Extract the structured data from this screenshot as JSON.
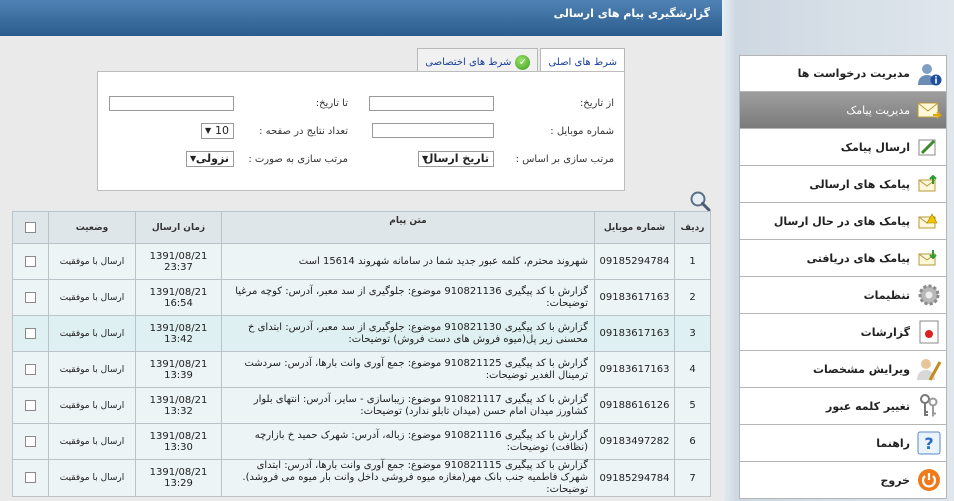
{
  "header": {
    "title": "گزارشگیری پیام های ارسالی"
  },
  "tabs": [
    {
      "label": "شرط های اصلی",
      "active": true
    },
    {
      "label": "شرط های اختصاصی",
      "active": false
    }
  ],
  "filters": {
    "from_date_label": "از تاریخ:",
    "to_date_label": "تا تاریخ:",
    "mobile_label": "شماره موبایل :",
    "page_size_label": "تعداد نتایج در صفحه :",
    "page_size_value": "10",
    "sort_by_label": "مرتب سازی بر اساس :",
    "sort_by_value": "تاریخ ارسال",
    "sort_order_label": "مرتب سازی به صورت :",
    "sort_order_value": "نزولی"
  },
  "table": {
    "columns": [
      "ردیف",
      "شماره موبایل",
      "متن پیام",
      "زمان ارسال",
      "وضعیت"
    ],
    "rows": [
      {
        "n": "1",
        "mobile": "09185294784",
        "text": "شهروند محترم، کلمه عبور جدید شما در سامانه شهروند 15614 است",
        "time": "1391/08/21 23:37",
        "status": "ارسال با موفقیت"
      },
      {
        "n": "2",
        "mobile": "09183617163",
        "text": "گزارش با کد پیگیری 910821136 موضوع: جلوگیری از سد معبر، آدرس: کوچه مرغیا توضیحات:",
        "time": "1391/08/21 16:54",
        "status": "ارسال با موفقیت"
      },
      {
        "n": "3",
        "mobile": "09183617163",
        "text": "گزارش با کد پیگیری 910821130 موضوع: جلوگیری از سد معبر، آدرس: ابتدای خ محسنی زیر پل(میوه فروش های دست فروش) توضیحات:",
        "time": "1391/08/21 13:42",
        "status": "ارسال با موفقیت"
      },
      {
        "n": "4",
        "mobile": "09183617163",
        "text": "گزارش با کد پیگیری 910821125 موضوع: جمع آوری وانت بارها، آدرس: سردشت ترمینال الغدیر توضیحات:",
        "time": "1391/08/21 13:39",
        "status": "ارسال با موفقیت"
      },
      {
        "n": "5",
        "mobile": "09188616126",
        "text": "گزارش با کد پیگیری 910821117 موضوع: زیباسازی - سایر، آدرس: انتهای بلوار کشاورز میدان امام حسن (میدان تابلو ندارد) توضیحات:",
        "time": "1391/08/21 13:32",
        "status": "ارسال با موفقیت"
      },
      {
        "n": "6",
        "mobile": "09183497282",
        "text": "گزارش با کد پیگیری 910821116 موضوع: زباله، آدرس: شهرک حمید خ بازارچه (نظافت) توضیحات:",
        "time": "1391/08/21 13:30",
        "status": "ارسال با موفقیت"
      },
      {
        "n": "7",
        "mobile": "09185294784",
        "text": "گزارش با کد پیگیری 910821115 موضوع: جمع آوری وانت بارها، آدرس: ابتدای شهرک فاطمیه جنب بانک مهر(مغازه میوه فروشی داخل وانت بار میوه می فروشد). توضیحات:",
        "time": "1391/08/21 13:29",
        "status": "ارسال با موفقیت"
      }
    ]
  },
  "sidebar": {
    "items": [
      {
        "label": "مدیریت درخواست ها",
        "icon": "user-info-icon"
      },
      {
        "label": "مدیریت پیامک",
        "icon": "envelope-icon",
        "active": true
      },
      {
        "label": "ارسال پیامک",
        "icon": "pen-icon",
        "sub": true
      },
      {
        "label": "پیامک های ارسالی",
        "icon": "envelope-up-icon",
        "sub": true
      },
      {
        "label": "پیامک های در حال ارسال",
        "icon": "envelope-warning-icon",
        "sub": true
      },
      {
        "label": "پیامک های دریافتی",
        "icon": "envelope-down-icon",
        "sub": true
      },
      {
        "label": "تنظیمات",
        "icon": "gear-icon"
      },
      {
        "label": "گزارشات",
        "icon": "report-icon"
      },
      {
        "label": "ویرایش مشخصات",
        "icon": "user-edit-icon"
      },
      {
        "label": "تغییر کلمه عبور",
        "icon": "keys-icon"
      },
      {
        "label": "راهنما",
        "icon": "help-icon"
      },
      {
        "label": "خروج",
        "icon": "power-icon"
      }
    ]
  }
}
